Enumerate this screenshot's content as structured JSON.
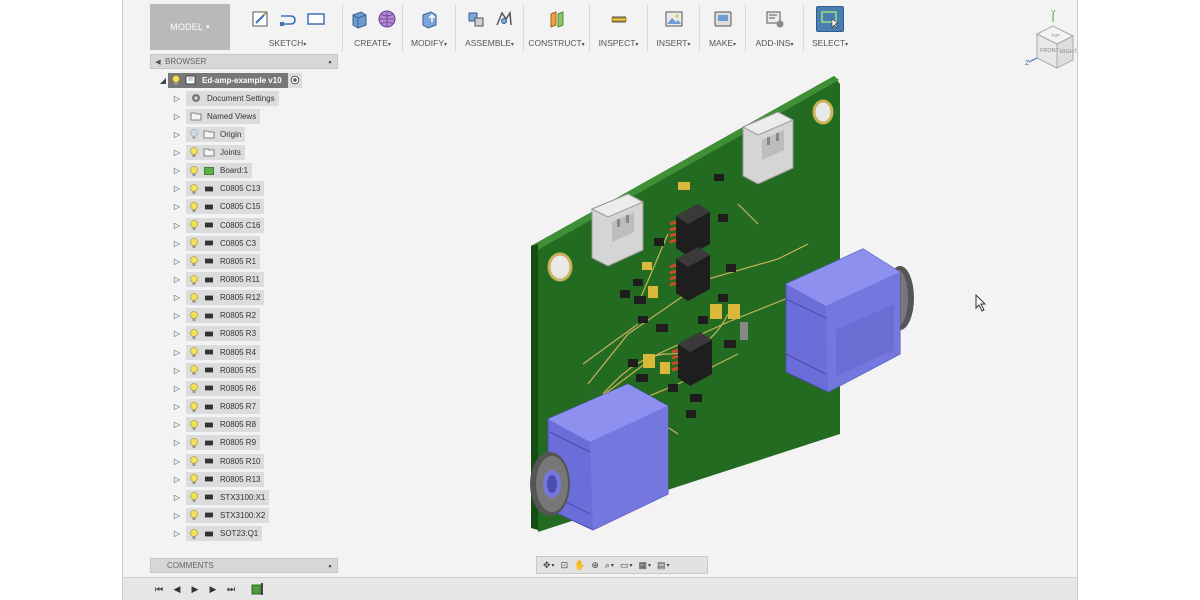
{
  "toolbar": {
    "workspace": "MODEL",
    "groups": [
      {
        "label": "SKETCH"
      },
      {
        "label": "CREATE"
      },
      {
        "label": "MODIFY"
      },
      {
        "label": "ASSEMBLE"
      },
      {
        "label": "CONSTRUCT"
      },
      {
        "label": "INSPECT"
      },
      {
        "label": "INSERT"
      },
      {
        "label": "MAKE"
      },
      {
        "label": "ADD-INS"
      },
      {
        "label": "SELECT"
      }
    ],
    "caret": "▾"
  },
  "viewcube": {
    "axis_y": "Y",
    "axis_z": "Z",
    "face_top": "TOP",
    "face_front": "FRONT",
    "face_right": "RIGHT"
  },
  "browser": {
    "title": "BROWSER",
    "root": "Ed-amp-example v10",
    "items": [
      {
        "label": "Document Settings",
        "icon": "gear-icon"
      },
      {
        "label": "Named Views",
        "icon": "folder-icon"
      },
      {
        "label": "Origin",
        "icon": "folder-icon"
      },
      {
        "label": "Joints",
        "icon": "folder-icon"
      },
      {
        "label": "Board:1",
        "icon": "body-icon"
      },
      {
        "label": "C0805 C13",
        "icon": "component-icon"
      },
      {
        "label": "C0805 C15",
        "icon": "component-icon"
      },
      {
        "label": "C0805 C16",
        "icon": "component-icon"
      },
      {
        "label": "C0805 C3",
        "icon": "component-icon"
      },
      {
        "label": "R0805 R1",
        "icon": "component-icon"
      },
      {
        "label": "R0805 R11",
        "icon": "component-icon"
      },
      {
        "label": "R0805 R12",
        "icon": "component-icon"
      },
      {
        "label": "R0805 R2",
        "icon": "component-icon"
      },
      {
        "label": "R0805 R3",
        "icon": "component-icon"
      },
      {
        "label": "R0805 R4",
        "icon": "component-icon"
      },
      {
        "label": "R0805 R5",
        "icon": "component-icon"
      },
      {
        "label": "R0805 R6",
        "icon": "component-icon"
      },
      {
        "label": "R0805 R7",
        "icon": "component-icon"
      },
      {
        "label": "R0805 R8",
        "icon": "component-icon"
      },
      {
        "label": "R0805 R9",
        "icon": "component-icon"
      },
      {
        "label": "R0805 R10",
        "icon": "component-icon"
      },
      {
        "label": "R0805 R13",
        "icon": "component-icon"
      },
      {
        "label": "STX3100:X1",
        "icon": "component-icon"
      },
      {
        "label": "STX3100:X2",
        "icon": "component-icon"
      },
      {
        "label": "SOT23:Q1",
        "icon": "component-icon"
      }
    ]
  },
  "comments": {
    "title": "COMMENTS"
  },
  "colors": {
    "pcb": "#2f7a2a",
    "trace": "#c9b25a",
    "connector": "#7d7fe0",
    "accent": "#4a7fb4"
  }
}
